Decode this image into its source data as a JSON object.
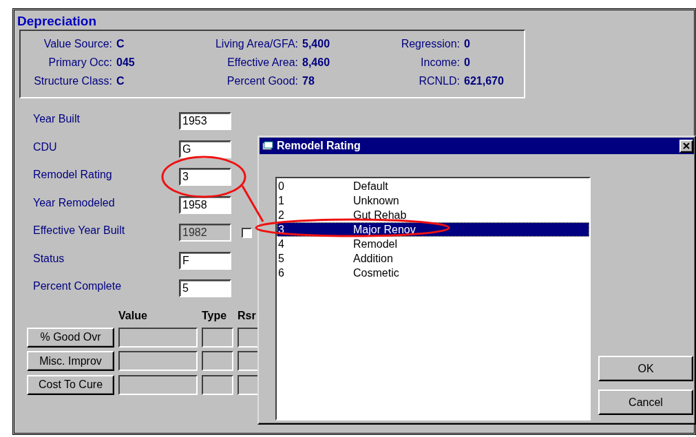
{
  "window": {
    "title": "Depreciation"
  },
  "summary": {
    "columns": [
      [
        {
          "label": "Value Source:",
          "value": "C"
        },
        {
          "label": "Primary Occ:",
          "value": "045"
        },
        {
          "label": "Structure Class:",
          "value": "C"
        }
      ],
      [
        {
          "label": "Living Area/GFA:",
          "value": "5,400"
        },
        {
          "label": "Effective Area:",
          "value": "8,460"
        },
        {
          "label": "Percent Good:",
          "value": "78"
        }
      ],
      [
        {
          "label": "Regression:",
          "value": "0"
        },
        {
          "label": "Income:",
          "value": "0"
        },
        {
          "label": "RCNLD:",
          "value": "621,670"
        }
      ]
    ]
  },
  "fields": [
    {
      "label": "Year Built",
      "value": "1953",
      "disabled": false
    },
    {
      "label": "CDU",
      "value": "G",
      "disabled": false
    },
    {
      "label": "Remodel Rating",
      "value": "3",
      "disabled": false
    },
    {
      "label": "Year Remodeled",
      "value": "1958",
      "disabled": false
    },
    {
      "label": "Effective Year Built",
      "value": "1982",
      "disabled": true,
      "checkbox": {
        "checked": false
      }
    },
    {
      "label": "Status",
      "value": "F",
      "disabled": false
    },
    {
      "label": "Percent Complete",
      "value": "5",
      "disabled": false
    }
  ],
  "overrides": {
    "columns": [
      "Value",
      "Type",
      "Rsr"
    ],
    "rows": [
      {
        "button": "% Good Ovr"
      },
      {
        "button": "Misc. Improv"
      },
      {
        "button": "Cost To Cure"
      }
    ]
  },
  "dialog": {
    "title": "Remodel Rating",
    "items": [
      {
        "code": "0",
        "name": "Default",
        "selected": false
      },
      {
        "code": "1",
        "name": "Unknown",
        "selected": false
      },
      {
        "code": "2",
        "name": "Gut Rehab",
        "selected": false
      },
      {
        "code": "3",
        "name": "Major Renov",
        "selected": true
      },
      {
        "code": "4",
        "name": "Remodel",
        "selected": false
      },
      {
        "code": "5",
        "name": "Addition",
        "selected": false
      },
      {
        "code": "6",
        "name": "Cosmetic",
        "selected": false
      }
    ],
    "buttons": [
      "OK",
      "Cancel"
    ]
  }
}
